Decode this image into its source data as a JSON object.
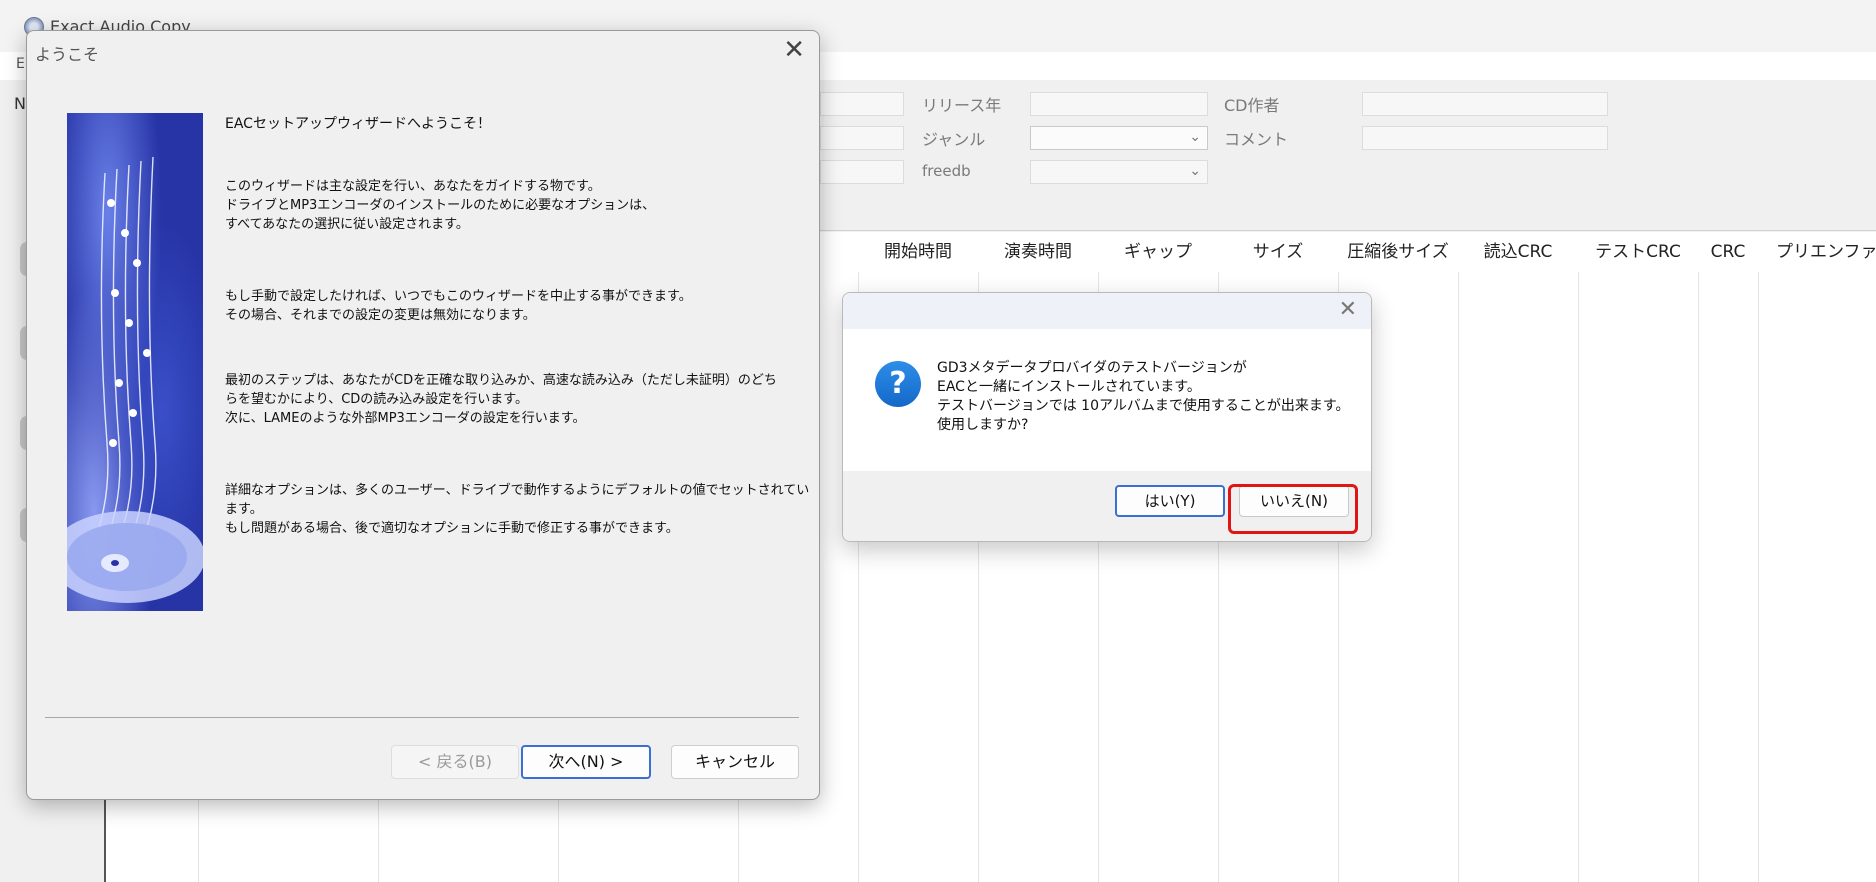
{
  "main_window": {
    "title": "Exact Audio Copy",
    "menu_fragment": "E",
    "side_fragment": "N",
    "fields": {
      "release_year_label": "リリース年",
      "genre_label": "ジャンル",
      "freedb_label": "freedb",
      "cd_artist_label": "CD作者",
      "comment_label": "コメント"
    },
    "columns": [
      "開始時間",
      "演奏時間",
      "ギャップ",
      "サイズ",
      "圧縮後サイズ",
      "読込CRC",
      "テストCRC",
      "CRC",
      "プリエンファシ"
    ]
  },
  "wizard": {
    "title": "ようこそ",
    "heading": "EACセットアップウィザードへようこそ！",
    "paragraphs": [
      [
        "このウィザードは主な設定を行い、あなたをガイドする物です。",
        "ドライブとMP3エンコーダのインストールのために必要なオプションは、",
        "すべてあなたの選択に従い設定されます。"
      ],
      [
        "もし手動で設定したければ、いつでもこのウィザードを中止する事ができます。",
        "その場合、それまでの設定の変更は無効になります。"
      ],
      [
        "最初のステップは、あなたがCDを正確な取り込みか、高速な読み込み（ただし未証明）のどち",
        "らを望むかにより、CDの読み込み設定を行います。",
        "次に、LAMEのような外部MP3エンコーダの設定を行います。"
      ],
      [
        "詳細なオプションは、多くのユーザー、ドライブで動作するようにデフォルトの値でセットされてい",
        "ます。",
        "もし問題がある場合、後で適切なオプションに手動で修正する事ができます。"
      ]
    ],
    "buttons": {
      "back": "< 戻る(B)",
      "next": "次へ(N) >",
      "cancel": "キャンセル"
    }
  },
  "message_box": {
    "icon": "question-icon",
    "lines": [
      "GD3メタデータプロバイダのテストバージョンが",
      "EACと一緒にインストールされています。",
      "テストバージョンでは 10アルバムまで使用することが出来ます。",
      "使用しますか?"
    ],
    "buttons": {
      "yes": "はい(Y)",
      "no": "いいえ(N)"
    },
    "highlight_color": "#e01616"
  }
}
